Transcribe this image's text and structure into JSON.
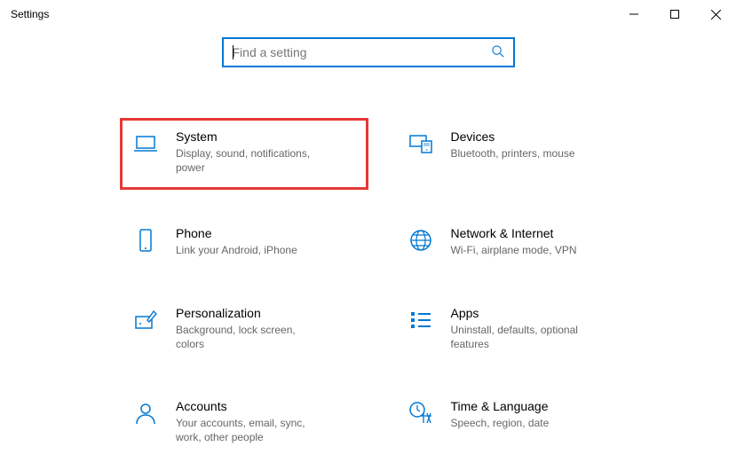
{
  "window": {
    "title": "Settings"
  },
  "search": {
    "placeholder": "Find a setting"
  },
  "tiles": [
    {
      "title": "System",
      "desc": "Display, sound, notifications, power",
      "highlight": true
    },
    {
      "title": "Devices",
      "desc": "Bluetooth, printers, mouse"
    },
    {
      "title": "Phone",
      "desc": "Link your Android, iPhone"
    },
    {
      "title": "Network & Internet",
      "desc": "Wi-Fi, airplane mode, VPN"
    },
    {
      "title": "Personalization",
      "desc": "Background, lock screen, colors"
    },
    {
      "title": "Apps",
      "desc": "Uninstall, defaults, optional features"
    },
    {
      "title": "Accounts",
      "desc": "Your accounts, email, sync, work, other people"
    },
    {
      "title": "Time & Language",
      "desc": "Speech, region, date"
    }
  ]
}
